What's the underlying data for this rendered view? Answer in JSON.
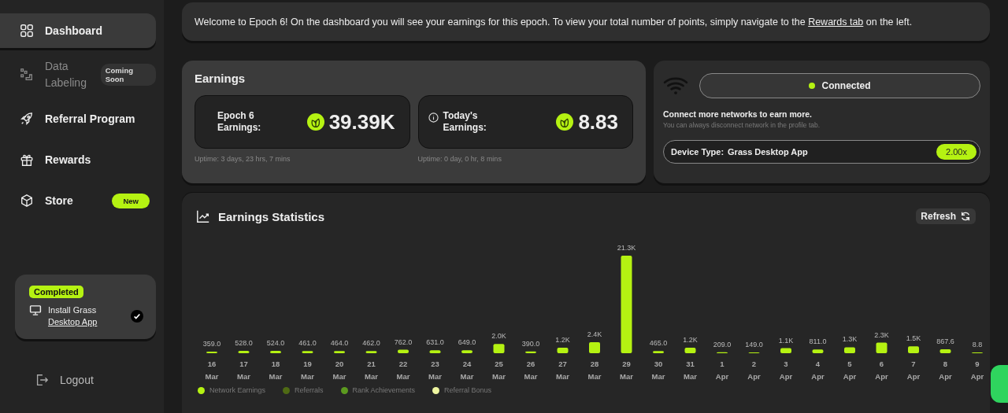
{
  "sidebar": {
    "items": [
      {
        "label": "Dashboard",
        "selected": true,
        "disabled": false
      },
      {
        "label": "Data Labeling",
        "selected": false,
        "disabled": true,
        "badge": {
          "text": "Coming Soon",
          "kind": "muted"
        }
      },
      {
        "label": "Referral Program",
        "selected": false,
        "disabled": false
      },
      {
        "label": "Rewards",
        "selected": false,
        "disabled": false
      },
      {
        "label": "Store",
        "selected": false,
        "disabled": false,
        "badge": {
          "text": "New",
          "kind": "accent"
        }
      }
    ],
    "task": {
      "status": "Completed",
      "text": "Install Grass",
      "link": "Desktop App",
      "checked": true
    },
    "logout": "Logout"
  },
  "banner": {
    "text": "Welcome to Epoch 6! On the dashboard you will see your earnings for this epoch. To view your total number of points, simply navigate to the",
    "link": "Rewards tab",
    "after": "on the left."
  },
  "earnings": {
    "title": "Earnings",
    "tiles": [
      {
        "label": "Epoch 6 Earnings:",
        "value": "39.39K",
        "uptime": "Uptime: 3 days, 23 hrs, 7 mins",
        "info": false
      },
      {
        "label": "Today's Earnings:",
        "value": "8.83",
        "uptime": "Uptime: 0 day, 0 hr, 8 mins",
        "info": true
      }
    ]
  },
  "network": {
    "status": "Connected",
    "connected": true,
    "heading": "Connect more networks to earn more.",
    "note": "You can always disconnect network in the profile tab.",
    "device_label": "Device Type:",
    "device": "Grass Desktop App",
    "multiplier": "2.00x"
  },
  "stats": {
    "title": "Earnings Statistics",
    "refresh": "Refresh",
    "chart_data": {
      "type": "bar",
      "categories": [
        "16 Mar",
        "17 Mar",
        "18 Mar",
        "19 Mar",
        "20 Mar",
        "21 Mar",
        "22 Mar",
        "23 Mar",
        "24 Mar",
        "25 Mar",
        "26 Mar",
        "27 Mar",
        "28 Mar",
        "29 Mar",
        "30 Mar",
        "31 Mar",
        "1 Apr",
        "2 Apr",
        "3 Apr",
        "4 Apr",
        "5 Apr",
        "6 Apr",
        "7 Apr",
        "8 Apr",
        "9 Apr"
      ],
      "values": [
        359,
        528,
        524,
        461,
        464,
        462,
        762,
        631,
        649,
        2000,
        390,
        1200,
        2400,
        21300,
        465,
        1200,
        209,
        149,
        1100,
        811,
        1300,
        2300,
        1500,
        867.6,
        8.8
      ],
      "value_labels": [
        "359.0",
        "528.0",
        "524.0",
        "461.0",
        "464.0",
        "462.0",
        "762.0",
        "631.0",
        "649.0",
        "2.0K",
        "390.0",
        "1.2K",
        "2.4K",
        "21.3K",
        "465.0",
        "1.2K",
        "209.0",
        "149.0",
        "1.1K",
        "811.0",
        "1.3K",
        "2.3K",
        "1.5K",
        "867.6",
        "8.8"
      ]
    },
    "legend": [
      {
        "name": "Network Earnings",
        "color": "#b5f212"
      },
      {
        "name": "Referrals",
        "color": "#4f6a14"
      },
      {
        "name": "Rank Achievements",
        "color": "#5c9a1f"
      },
      {
        "name": "Referral Bonus",
        "color": "#eef5a0"
      }
    ]
  }
}
